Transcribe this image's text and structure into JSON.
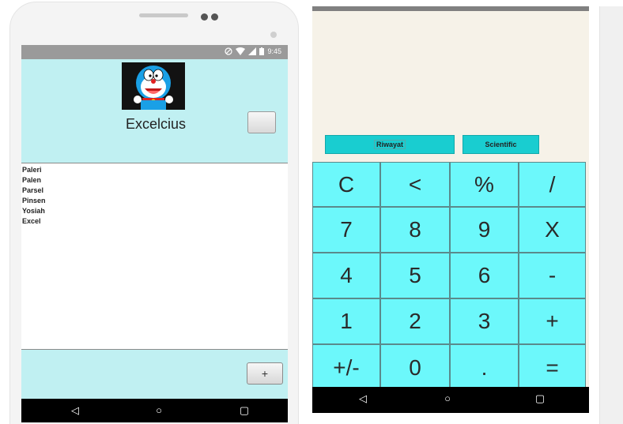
{
  "left_app": {
    "status_time": "9:45",
    "title": "Excelcius",
    "add_button_label": "+",
    "list_items": [
      "Paleri",
      "Palen",
      "Parsel",
      "Pinsen",
      "Yosiah",
      "Excel"
    ]
  },
  "right_app": {
    "tabs": [
      "Riwayat",
      "Scientific"
    ],
    "keys": [
      "C",
      "<",
      "%",
      "/",
      "7",
      "8",
      "9",
      "X",
      "4",
      "5",
      "6",
      "-",
      "1",
      "2",
      "3",
      "+",
      "+/-",
      "0",
      ".",
      "="
    ]
  },
  "colors": {
    "left_bg": "#c0f0f2",
    "keypad": "#6cf8fb",
    "tab": "#19cdd0",
    "calc_display": "#f6f2e8"
  },
  "icons": [
    "wifi-icon",
    "signal-icon",
    "battery-icon",
    "do-not-disturb-icon",
    "back-icon",
    "home-icon",
    "recents-icon"
  ]
}
